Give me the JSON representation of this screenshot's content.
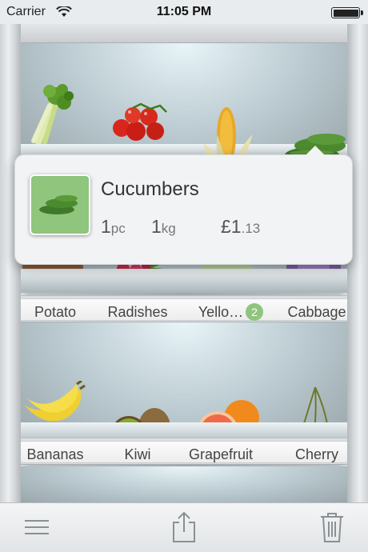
{
  "status_bar": {
    "carrier": "Carrier",
    "time": "11:05 PM"
  },
  "shelves": [
    {
      "items": [
        {
          "name": "celery-icon"
        },
        {
          "name": "tomatoes-icon"
        },
        {
          "name": "corn-icon"
        },
        {
          "name": "cucumbers-icon"
        }
      ]
    },
    {
      "labels": [
        "Potato",
        "Radishes",
        "Yello…",
        "Cabbage"
      ],
      "badge": "2"
    },
    {
      "labels": [
        "Bananas",
        "Kiwi",
        "Grapefruit",
        "Cherry"
      ]
    }
  ],
  "popup": {
    "title": "Cucumbers",
    "pieces_value": "1",
    "pieces_unit": "pc",
    "weight_value": "1",
    "weight_unit": "kg",
    "price_currency": "£",
    "price_major": "1",
    "price_minor": ".13"
  },
  "toolbar": {
    "icons": [
      "menu-icon",
      "share-icon",
      "trash-icon"
    ]
  },
  "colors": {
    "badge": "#8fc57d",
    "thumbnail": "#8fc57d"
  }
}
